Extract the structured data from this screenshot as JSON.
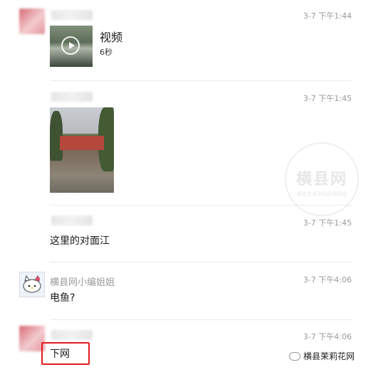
{
  "messages": [
    {
      "time": "3-7 下午1:44",
      "video": {
        "title": "视频",
        "duration": "6秒"
      }
    },
    {
      "time": "3-7 下午1:45"
    },
    {
      "time": "3-7 下午1:45",
      "text": "这里的对面江"
    },
    {
      "sender": "横县网小编姐姐",
      "time": "3-7 下午4:06",
      "text": "电鱼?"
    },
    {
      "time": "3-7 下午4:06",
      "text": "下网"
    }
  ],
  "watermark": {
    "title": "横县网",
    "subtitle": "横县生活资讯品牌网站"
  },
  "brand": {
    "name": "横县茉莉花网",
    "icon": "wechat-icon"
  },
  "highlight_color": "#e01e1e"
}
